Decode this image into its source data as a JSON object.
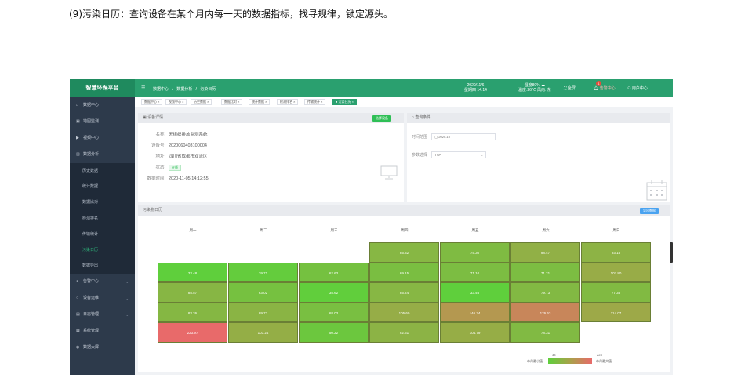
{
  "caption": "(9)污染日历：查询设备在某个月内每一天的数据指标，找寻规律，锁定源头。",
  "topbar": {
    "logo": "智慧环保平台",
    "menu_icon": "☰",
    "breadcrumb": [
      "数据中心",
      "/",
      "数据分析",
      "/",
      "污染日历"
    ],
    "date": "2020/11/6",
    "time": "星期四 14:14",
    "weather_line1": "湿度80% ☁",
    "weather_line2": "温度:26℃ 风向: 东",
    "fullscreen": "全屏",
    "alarm": "告警中心",
    "alarm_count": "1",
    "user": "用户中心"
  },
  "sidebar": {
    "items": [
      {
        "icon": "⌂",
        "label": "数据中心"
      },
      {
        "icon": "▣",
        "label": "地图监测"
      },
      {
        "icon": "▶",
        "label": "视频中心"
      },
      {
        "icon": "▥",
        "label": "数据分析",
        "chev": "⌃"
      }
    ],
    "sub_items": [
      "历史数据",
      "统计数据",
      "数据比对",
      "检测排名",
      "传输统计",
      "污染日历",
      "数据导出"
    ],
    "items_after": [
      {
        "icon": "●",
        "label": "告警中心",
        "chev": "⌄"
      },
      {
        "icon": "○",
        "label": "设备运维",
        "chev": "⌄"
      },
      {
        "icon": "▤",
        "label": "日志管理",
        "chev": "⌄"
      },
      {
        "icon": "▦",
        "label": "系统管理",
        "chev": "⌄"
      },
      {
        "icon": "◉",
        "label": "数据大屏"
      }
    ]
  },
  "tabs": [
    "数据中心 ×",
    "视频中心 ×",
    "历史数据 ×",
    "数据比对 ×",
    "统计数据 ×",
    "检测排名 ×",
    "传输统计 ×",
    "● 污染日历 ×"
  ],
  "device_panel": {
    "title": "设备详情",
    "select_button": "选择设备",
    "rows": [
      {
        "label": "名称:",
        "value": "无组织排放监测系统"
      },
      {
        "label": "设备号:",
        "value": "2020060403100004"
      },
      {
        "label": "地址:",
        "value": "四川省成都市双流区"
      },
      {
        "label": "状态:",
        "value": "在线"
      },
      {
        "label": "数据时间:",
        "value": "2020-11-05 14:12:55"
      }
    ]
  },
  "query_panel": {
    "title": "查询条件",
    "time_label": "时间范围",
    "time_value": "2020-10",
    "param_label": "参数选择",
    "param_value": "TSP"
  },
  "calendar_panel": {
    "title": "污染物日历",
    "export_button": "导出数据",
    "weekdays": [
      "周一",
      "周二",
      "周三",
      "周四",
      "周五",
      "周六",
      "周日"
    ],
    "weeks": [
      [
        "",
        "",
        "",
        "85.32",
        "75.30",
        "98.47",
        "93.18"
      ],
      [
        "33.48",
        "39.71",
        "62.63",
        "69.15",
        "71.10",
        "71.21",
        "107.80"
      ],
      [
        "85.57",
        "63.02",
        "35.62",
        "85.24",
        "33.46",
        "79.73",
        "77.38"
      ],
      [
        "83.26",
        "89.73",
        "68.03",
        "105.60",
        "146.24",
        "176.63",
        "114.07"
      ],
      [
        "223.97",
        "103.24",
        "50.22",
        "92.61",
        "104.79",
        "78.31",
        ""
      ]
    ],
    "legend_min_value": "33",
    "legend_max_value": "223",
    "legend_min_label": "本月最小值",
    "legend_max_label": "本月最大值",
    "color_low": "#5fcf3c",
    "color_high": "#e86a6a"
  }
}
